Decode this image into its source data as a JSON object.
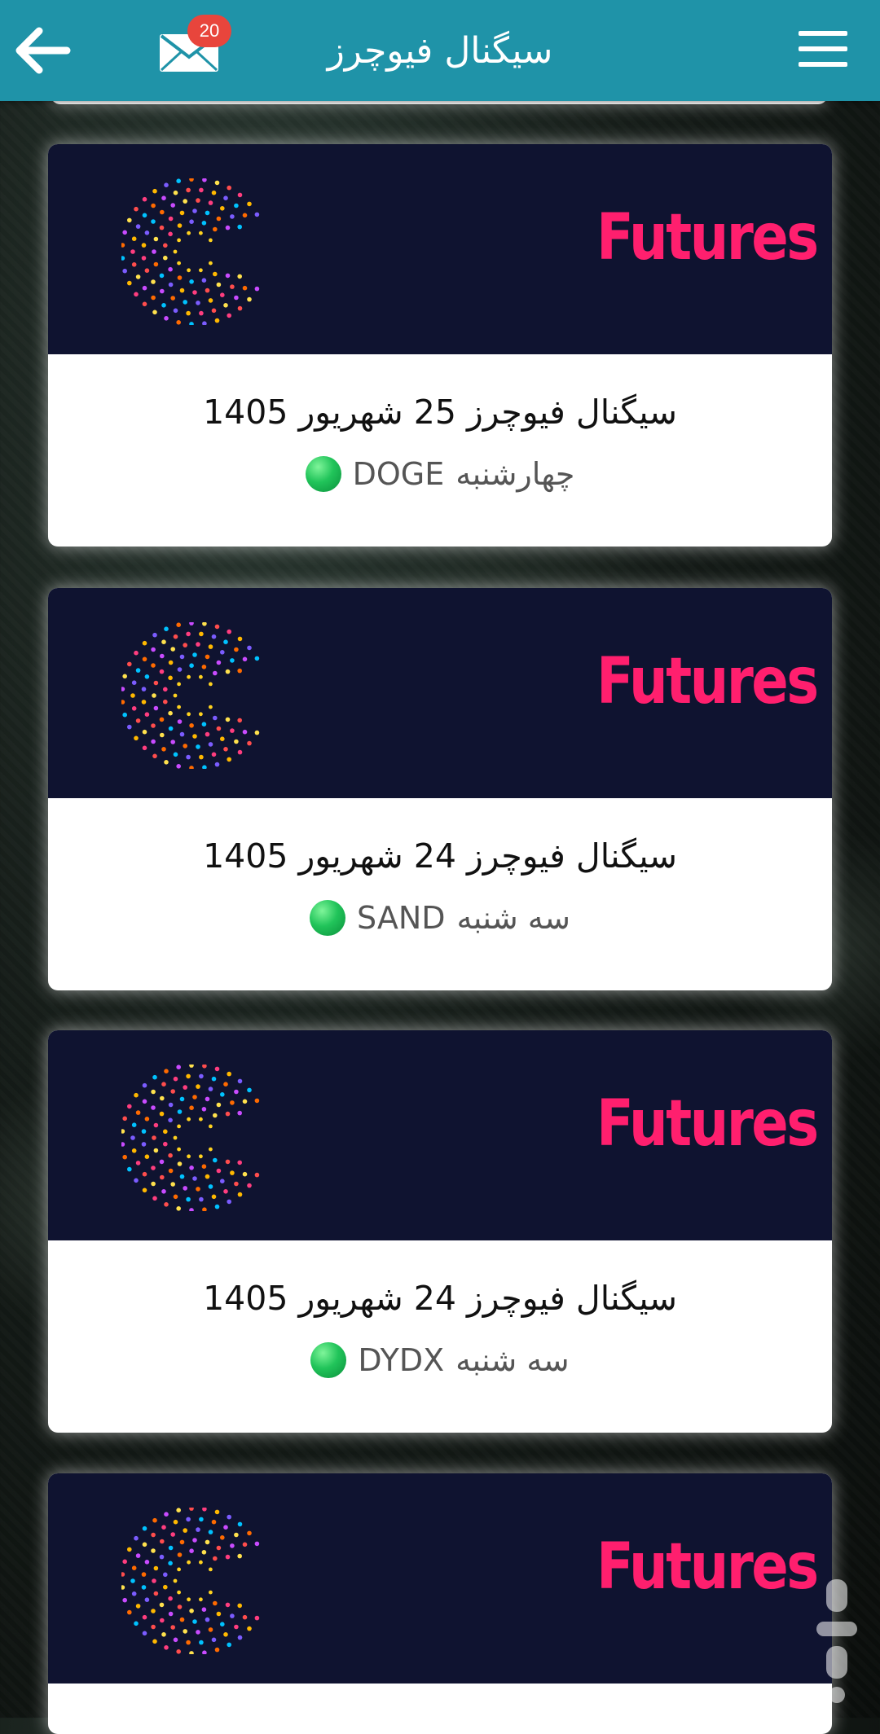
{
  "header": {
    "title": "سیگنال فیوچرز",
    "mail_badge_count": "20",
    "bar_color": "#1f93a8"
  },
  "cards": [
    {
      "banner_text": "Futures",
      "title": "سیگنال فیوچرز 25 شهریور 1405",
      "day": "چهارشنبه",
      "symbol": "DOGE",
      "status": "green-circle"
    },
    {
      "banner_text": "Futures",
      "title": "سیگنال فیوچرز 24 شهریور 1405",
      "day": "سه شنبه",
      "symbol": "SAND",
      "status": "green-circle"
    },
    {
      "banner_text": "Futures",
      "title": "سیگنال فیوچرز 24 شهریور 1405",
      "day": "سه شنبه",
      "symbol": "DYDX",
      "status": "green-circle"
    },
    {
      "banner_text": "Futures"
    }
  ],
  "colors": {
    "banner_bg": "#0f1330",
    "futures_text": "#ff1f6e",
    "status_green": "#21c45a",
    "badge": "#e8453c"
  },
  "icons": {
    "back": "arrow-left-icon",
    "mail": "envelope-icon",
    "menu": "hamburger-menu-icon",
    "logo": "dotted-c-logo"
  }
}
